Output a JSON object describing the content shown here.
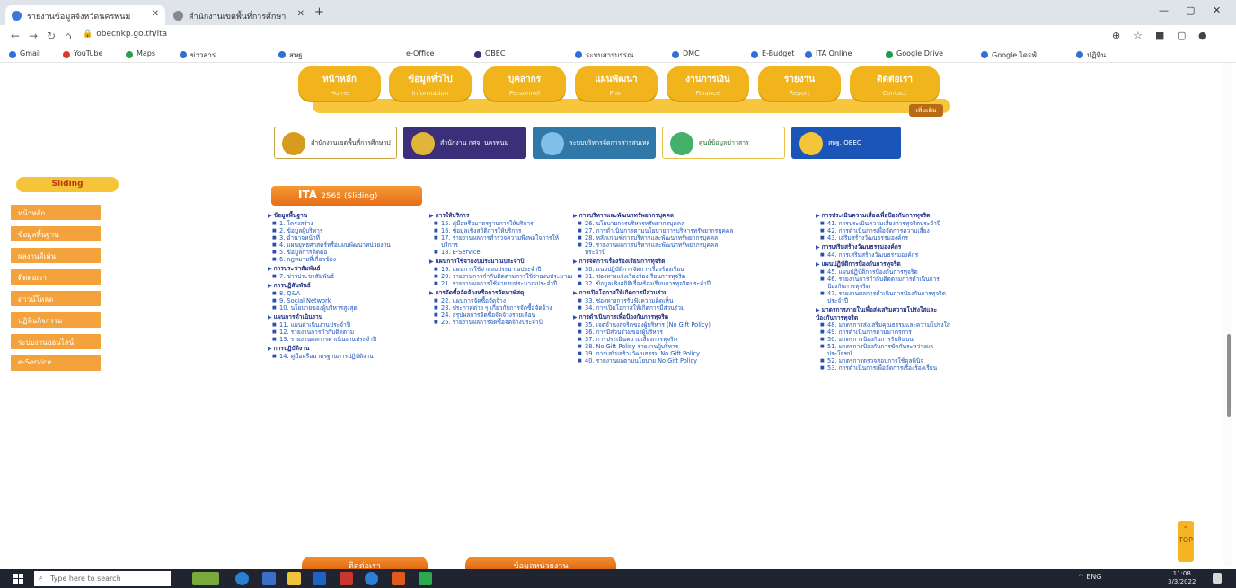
{
  "browser": {
    "tabs": [
      {
        "title": "รายงานข้อมูลจังหวัดนครพนม"
      },
      {
        "title": "สำนักงานเขตพื้นที่การศึกษา"
      }
    ],
    "url": "obecnkp.go.th/ita",
    "bookmarks": [
      "Gmail",
      "YouTube",
      "Maps",
      "ข่าวสาร",
      "สพฐ.",
      "e-Office",
      "OBEC",
      "ระบบสารบรรณ",
      "DMC",
      "E-Budget",
      "ITA Online",
      "Google Drive",
      "Google ไดรฟ์",
      "ปฏิทิน"
    ]
  },
  "menu": [
    {
      "label": "หน้าหลัก",
      "sub": "Home"
    },
    {
      "label": "ข้อมูลทั่วไป",
      "sub": "Information"
    },
    {
      "label": "บุคลากร",
      "sub": "Personnel"
    },
    {
      "label": "แผนพัฒนา",
      "sub": "Plan"
    },
    {
      "label": "งานการเงิน",
      "sub": "Finance"
    },
    {
      "label": "รายงาน",
      "sub": "Report"
    },
    {
      "label": "ติดต่อเรา",
      "sub": "Contact"
    }
  ],
  "menu_more": "เพิ่มเติม",
  "banners": [
    {
      "text": "สำนักงานเขตพื้นที่การศึกษาประถมศึกษา",
      "bg": "#ffffff",
      "fg": "#333333",
      "border": "#c9a34a",
      "emb": "#d79b1d"
    },
    {
      "text": "สำนักงาน กศจ. นครพนม",
      "bg": "#3a2f78",
      "fg": "#ffffff",
      "border": "#3a2f78",
      "emb": "#e0b53a"
    },
    {
      "text": "ระบบบริหารจัดการสารสนเทศ",
      "bg": "#2f78a8",
      "fg": "#ffffff",
      "border": "#2f78a8",
      "emb": "#7ec0e8"
    },
    {
      "text": "ศูนย์ข้อมูลข่าวสาร",
      "bg": "#ffffff",
      "fg": "#1f6e2c",
      "border": "#e8c04a",
      "emb": "#44b06a"
    },
    {
      "text": "สพฐ. OBEC",
      "bg": "#1c55b8",
      "fg": "#ffffff",
      "border": "#1c55b8",
      "emb": "#f2c53a"
    }
  ],
  "sidebar": {
    "toggle": "Sliding",
    "items": [
      "หน้าหลัก",
      "ข้อมูลพื้นฐาน",
      "ผลงานดีเด่น",
      "ติดต่อเรา",
      "ดาวน์โหลด",
      "ปฏิทินกิจกรรม",
      "ระบบงานออนไลน์",
      "e-Service"
    ]
  },
  "ita": {
    "title": "ITA",
    "subtitle": "2565 (Sliding)"
  },
  "columns": [
    {
      "entries": [
        {
          "t": "h",
          "v": "ข้อมูลพื้นฐาน"
        },
        {
          "t": "i",
          "v": "1. โครงสร้าง"
        },
        {
          "t": "i",
          "v": "2. ข้อมูลผู้บริหาร"
        },
        {
          "t": "i",
          "v": "3. อำนาจหน้าที่"
        },
        {
          "t": "i",
          "v": "4. แผนยุทธศาสตร์หรือแผนพัฒนาหน่วยงาน"
        },
        {
          "t": "i",
          "v": "5. ข้อมูลการติดต่อ"
        },
        {
          "t": "i",
          "v": "6. กฎหมายที่เกี่ยวข้อง"
        },
        {
          "t": "h",
          "v": "การประชาสัมพันธ์"
        },
        {
          "t": "i",
          "v": "7. ข่าวประชาสัมพันธ์"
        },
        {
          "t": "h",
          "v": "การปฏิสัมพันธ์"
        },
        {
          "t": "i",
          "v": "8. Q&A"
        },
        {
          "t": "i",
          "v": "9. Social Network"
        },
        {
          "t": "i",
          "v": "10. นโยบายของผู้บริหารสูงสุด"
        },
        {
          "t": "h",
          "v": "แผนการดำเนินงาน"
        },
        {
          "t": "i",
          "v": "11. แผนดำเนินงานประจำปี"
        },
        {
          "t": "i",
          "v": "12. รายงานการกำกับติดตาม"
        },
        {
          "t": "i",
          "v": "13. รายงานผลการดำเนินงานประจำปี"
        },
        {
          "t": "h",
          "v": "การปฏิบัติงาน"
        },
        {
          "t": "i",
          "v": "14. คู่มือหรือมาตรฐานการปฏิบัติงาน"
        }
      ]
    },
    {
      "entries": [
        {
          "t": "h",
          "v": "การให้บริการ"
        },
        {
          "t": "i",
          "v": "15. คู่มือหรือมาตรฐานการให้บริการ"
        },
        {
          "t": "i",
          "v": "16. ข้อมูลเชิงสถิติการให้บริการ"
        },
        {
          "t": "i",
          "v": "17. รายงานผลการสำรวจความพึงพอใจการให้บริการ"
        },
        {
          "t": "i",
          "v": "18. E-Service"
        },
        {
          "t": "h",
          "v": "แผนการใช้จ่ายงบประมาณประจำปี"
        },
        {
          "t": "i",
          "v": "19. แผนการใช้จ่ายงบประมาณประจำปี"
        },
        {
          "t": "i",
          "v": "20. รายงานการกำกับติดตามการใช้จ่ายงบประมาณ"
        },
        {
          "t": "i",
          "v": "21. รายงานผลการใช้จ่ายงบประมาณประจำปี"
        },
        {
          "t": "h",
          "v": "การจัดซื้อจัดจ้างหรือการจัดหาพัสดุ"
        },
        {
          "t": "i",
          "v": "22. แผนการจัดซื้อจัดจ้าง"
        },
        {
          "t": "i",
          "v": "23. ประกาศต่าง ๆ เกี่ยวกับการจัดซื้อจัดจ้าง"
        },
        {
          "t": "i",
          "v": "24. สรุปผลการจัดซื้อจัดจ้างรายเดือน"
        },
        {
          "t": "i",
          "v": "25. รายงานผลการจัดซื้อจัดจ้างประจำปี"
        }
      ]
    },
    {
      "entries": [
        {
          "t": "h",
          "v": "การบริหารและพัฒนาทรัพยากรบุคคล"
        },
        {
          "t": "i",
          "v": "26. นโยบายการบริหารทรัพยากรบุคคล"
        },
        {
          "t": "i",
          "v": "27. การดำเนินการตามนโยบายการบริหารทรัพยากรบุคคล"
        },
        {
          "t": "i",
          "v": "28. หลักเกณฑ์การบริหารและพัฒนาทรัพยากรบุคคล"
        },
        {
          "t": "i",
          "v": "29. รายงานผลการบริหารและพัฒนาทรัพยากรบุคคลประจำปี"
        },
        {
          "t": "h",
          "v": "การจัดการเรื่องร้องเรียนการทุจริต"
        },
        {
          "t": "i",
          "v": "30. แนวปฏิบัติการจัดการเรื่องร้องเรียน"
        },
        {
          "t": "i",
          "v": "31. ช่องทางแจ้งเรื่องร้องเรียนการทุจริต"
        },
        {
          "t": "i",
          "v": "32. ข้อมูลเชิงสถิติเรื่องร้องเรียนการทุจริตประจำปี"
        },
        {
          "t": "h",
          "v": "การเปิดโอกาสให้เกิดการมีส่วนร่วม"
        },
        {
          "t": "i",
          "v": "33. ช่องทางการรับฟังความคิดเห็น"
        },
        {
          "t": "i",
          "v": "34. การเปิดโอกาสให้เกิดการมีส่วนร่วม"
        },
        {
          "t": "h",
          "v": "การดำเนินการเพื่อป้องกันการทุจริต"
        },
        {
          "t": "i",
          "v": "35. เจตจำนงสุจริตของผู้บริหาร (No Gift Policy)"
        },
        {
          "t": "i",
          "v": "36. การมีส่วนร่วมของผู้บริหาร"
        },
        {
          "t": "i",
          "v": "37. การประเมินความเสี่ยงการทุจริต"
        },
        {
          "t": "i",
          "v": "38. No Gift Policy รายงานผู้บริหาร"
        },
        {
          "t": "i",
          "v": "39. การเสริมสร้างวัฒนธรรม No Gift Policy"
        },
        {
          "t": "i",
          "v": "40. รายงานผลตามนโยบาย No Gift Policy"
        }
      ]
    },
    {
      "entries": [
        {
          "t": "h",
          "v": "การประเมินความเสี่ยงเพื่อป้องกันการทุจริต"
        },
        {
          "t": "i",
          "v": "41. การประเมินความเสี่ยงการทุจริตประจำปี"
        },
        {
          "t": "i",
          "v": "42. การดำเนินการเพื่อจัดการความเสี่ยง"
        },
        {
          "t": "i",
          "v": "43. เสริมสร้างวัฒนธรรมองค์กร"
        },
        {
          "t": "h",
          "v": "การเสริมสร้างวัฒนธรรมองค์กร"
        },
        {
          "t": "i",
          "v": "44. การเสริมสร้างวัฒนธรรมองค์กร"
        },
        {
          "t": "h",
          "v": "แผนปฏิบัติการป้องกันการทุจริต"
        },
        {
          "t": "i",
          "v": "45. แผนปฏิบัติการป้องกันการทุจริต"
        },
        {
          "t": "i",
          "v": "46. รายงานการกำกับติดตามการดำเนินการป้องกันการทุจริต"
        },
        {
          "t": "i",
          "v": "47. รายงานผลการดำเนินการป้องกันการทุจริตประจำปี"
        },
        {
          "t": "h",
          "v": "มาตรการภายในเพื่อส่งเสริมความโปร่งใสและป้องกันการทุจริต"
        },
        {
          "t": "i",
          "v": "48. มาตรการส่งเสริมคุณธรรมและความโปร่งใส"
        },
        {
          "t": "i",
          "v": "49. การดำเนินการตามมาตรการ"
        },
        {
          "t": "i",
          "v": "50. มาตรการป้องกันการรับสินบน"
        },
        {
          "t": "i",
          "v": "51. มาตรการป้องกันการขัดกันระหว่างผลประโยชน์"
        },
        {
          "t": "i",
          "v": "52. มาตรการตรวจสอบการใช้ดุลพินิจ"
        },
        {
          "t": "i",
          "v": "53. การดำเนินการเพื่อจัดการเรื่องร้องเรียน"
        }
      ]
    }
  ],
  "back_to_top": "TOP",
  "bottom_tabs": [
    "ติดต่อเรา",
    "ข้อมูลหน่วยงาน"
  ],
  "taskbar": {
    "search_placeholder": "Type here to search",
    "tray_text": "^  ENG",
    "time": "11:08",
    "date": "3/3/2022"
  }
}
